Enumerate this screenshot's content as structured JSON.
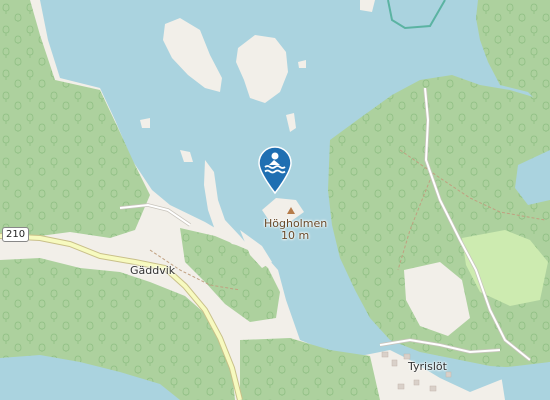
{
  "map": {
    "colors": {
      "water": "#aad3df",
      "land": "#f2efe9",
      "forest": "#add19e",
      "meadow": "#cdebb0",
      "road_major": "#f7fabf",
      "road_major_casing": "#c9c089",
      "road_minor": "#ffffff",
      "road_casing": "#c8c4bc",
      "pin": "#1f6fb2",
      "peak": "#b67c4a"
    },
    "places": {
      "gaddvik": "Gäddvik",
      "tyrislot": "Tyrislöt"
    },
    "peak": {
      "name": "Högholmen",
      "elevation": "10 m"
    },
    "road_shield": "210",
    "marker": {
      "icon": "swimming-icon"
    }
  }
}
